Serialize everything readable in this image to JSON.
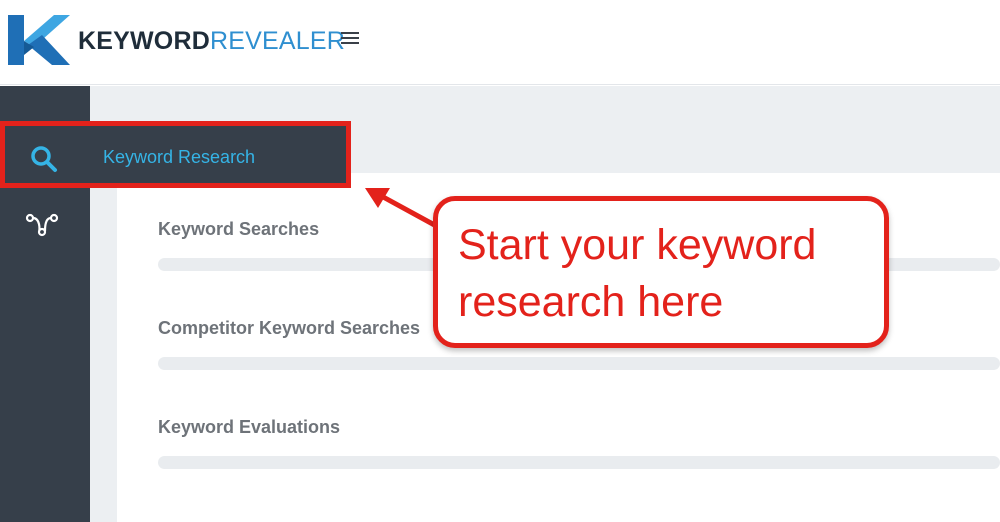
{
  "header": {
    "logo_bold": "KEYWORD",
    "logo_light": "REVEALER",
    "menu_icon": "hamburger-menu-icon"
  },
  "sidebar": {
    "items": [
      {
        "label": "Keyword Research",
        "icon": "search-icon"
      },
      {
        "label": "",
        "icon": "flow-network-icon"
      }
    ]
  },
  "main": {
    "sections": [
      {
        "title": "Keyword Searches"
      },
      {
        "title": "Competitor Keyword Searches"
      },
      {
        "title": "Keyword Evaluations"
      }
    ]
  },
  "annotation": {
    "callout_line1": "Start your keyword",
    "callout_line2": "research here"
  },
  "colors": {
    "accent": "#35b4e6",
    "brand_blue": "#2f8fd0",
    "sidebar": "#363f4a",
    "annotation_red": "#e3221b"
  }
}
